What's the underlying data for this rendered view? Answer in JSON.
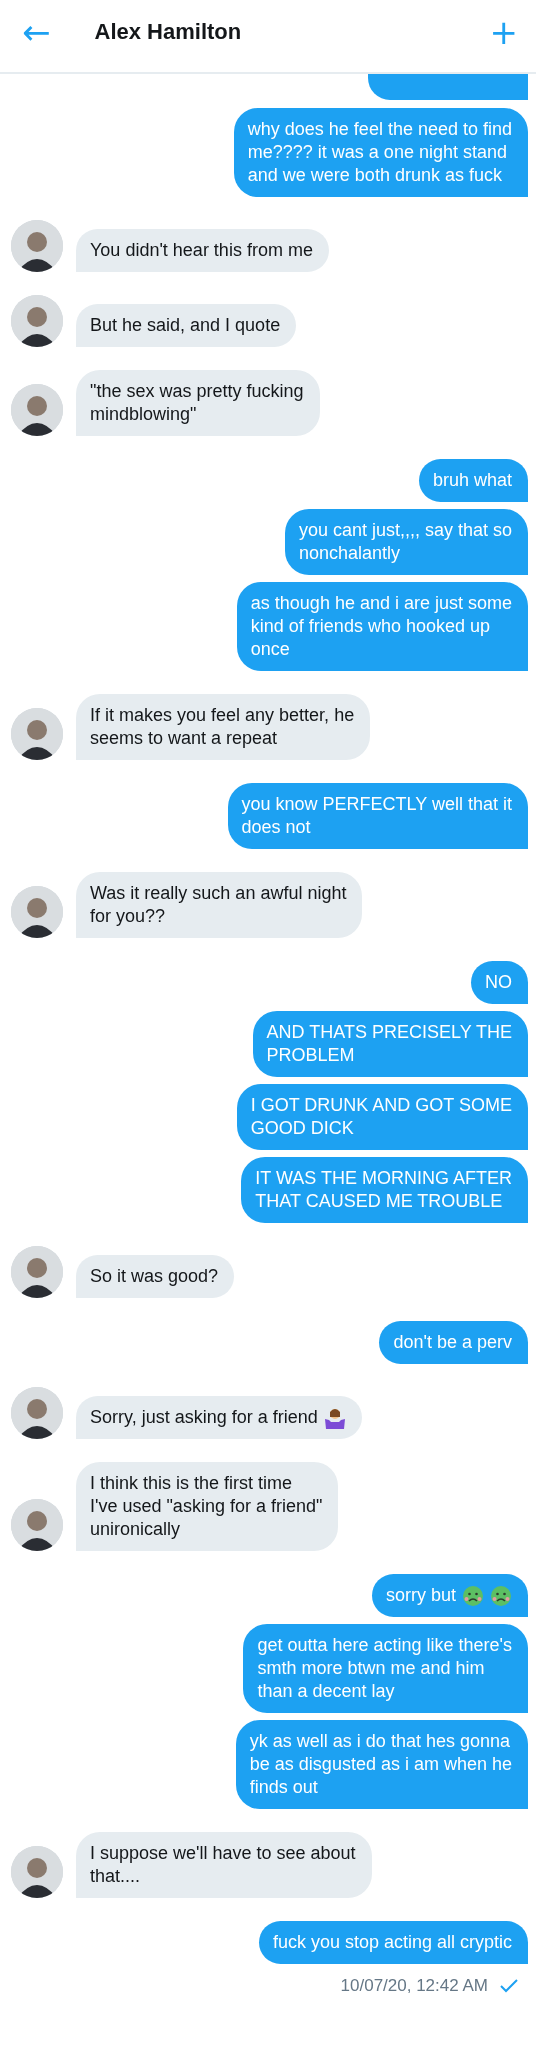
{
  "header": {
    "back": "←",
    "title": "Alex Hamilton",
    "add": "+"
  },
  "top_fragment": {
    "kind": "sent"
  },
  "messages": [
    {
      "kind": "sent",
      "lines": [
        "why does he feel the need to find",
        "me???? it was a one night stand",
        "and we were both drunk as fuck"
      ]
    },
    {
      "kind": "received",
      "lines": [
        "You didn't hear this from me"
      ]
    },
    {
      "kind": "received",
      "lines": [
        "But he said, and I quote"
      ]
    },
    {
      "kind": "received",
      "lines": [
        "\"the sex was pretty fucking",
        "mindblowing\""
      ]
    },
    {
      "kind": "sent",
      "lines": [
        "bruh what"
      ]
    },
    {
      "kind": "sent",
      "lines": [
        "you cant just,,,, say that so",
        "nonchalantly"
      ]
    },
    {
      "kind": "sent",
      "lines": [
        "as though he and i are just some",
        "kind of friends who hooked up",
        "once"
      ]
    },
    {
      "kind": "received",
      "lines": [
        "If it makes you feel any better, he",
        "seems to want a repeat"
      ]
    },
    {
      "kind": "sent",
      "lines": [
        "you know PERFECTLY well that it",
        "does not"
      ]
    },
    {
      "kind": "received",
      "lines": [
        "Was it really such an awful night",
        "for you??"
      ]
    },
    {
      "kind": "sent",
      "lines": [
        "NO"
      ]
    },
    {
      "kind": "sent",
      "lines": [
        "AND THATS PRECISELY THE",
        "PROBLEM"
      ]
    },
    {
      "kind": "sent",
      "lines": [
        "I GOT DRUNK AND GOT SOME",
        "GOOD DICK"
      ]
    },
    {
      "kind": "sent",
      "lines": [
        "IT WAS THE MORNING AFTER",
        "THAT CAUSED ME TROUBLE"
      ]
    },
    {
      "kind": "received",
      "lines": [
        "So it was good?"
      ]
    },
    {
      "kind": "sent",
      "lines": [
        "don't be a perv"
      ]
    },
    {
      "kind": "received",
      "lines": [
        "Sorry, just asking for a friend"
      ],
      "emoji": [
        {
          "kind": "shrug"
        }
      ]
    },
    {
      "kind": "received",
      "lines": [
        "I think this is the first time",
        "I've used \"asking for a friend\"",
        "unironically"
      ]
    },
    {
      "kind": "sent",
      "lines": [
        "sorry but"
      ],
      "emoji": [
        {
          "kind": "nauseated"
        },
        {
          "kind": "nauseated"
        }
      ]
    },
    {
      "kind": "sent",
      "lines": [
        "get outta here acting like there's",
        "smth more btwn me and him",
        "than a decent lay"
      ]
    },
    {
      "kind": "sent",
      "lines": [
        "yk as well as i do that hes gonna",
        "be as disgusted as i am when he",
        "finds out"
      ]
    },
    {
      "kind": "received",
      "lines": [
        "I suppose we'll have to see about",
        "that...."
      ]
    },
    {
      "kind": "sent",
      "lines": [
        "fuck you stop acting all cryptic"
      ]
    }
  ],
  "footer": {
    "timestamp": "10/07/20, 12:42 AM",
    "read": true
  }
}
